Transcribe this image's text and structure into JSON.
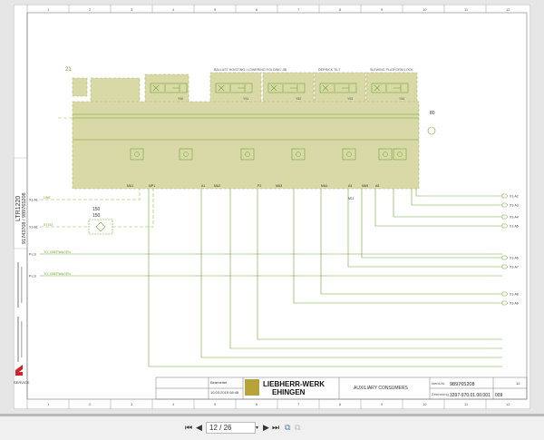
{
  "drawing": {
    "column_numbers": [
      "1",
      "2",
      "3",
      "4",
      "5",
      "6",
      "7",
      "8",
      "9",
      "10",
      "11",
      "12"
    ],
    "position_label": "21",
    "valve_groups": [
      "BALLAST HOISTING / LOWERING",
      "FOLDING JIB",
      "DERRICK TILT",
      "SLEWING PLATFORM LOCK"
    ],
    "valve_ids": [
      "Y50",
      "Y51",
      "Y52",
      "Y53",
      "Y54",
      "Y55"
    ],
    "bottom_ports": [
      "MA1",
      "MP1",
      "A1",
      "MA2",
      "P2",
      "MA3",
      "MA4",
      "A4",
      "MA5",
      "A5"
    ],
    "left_inputs": [
      "X1-A1",
      "X1-B1",
      "P-LS",
      "P-LS"
    ],
    "left_input_notes": [
      "LINE",
      "ST192",
      "TO_OBERWAGEN",
      "TO_OBERWAGEN"
    ],
    "filter_labels": [
      "150",
      "150"
    ],
    "right_outputs": [
      "X1-A2",
      "X1-A3",
      "X1-A4",
      "X1-A5",
      "X1-A6",
      "X1-A7",
      "X1-A8",
      "X1-A9"
    ],
    "gauge_label": "80",
    "sensor_label": "M11"
  },
  "side_strip": {
    "model": "LTR1220",
    "numbers": "91743708 / 989765208",
    "brand": "SERVICE"
  },
  "title_block": {
    "company_line1": "LIEBHERR-WERK",
    "company_line2": "EHINGEN",
    "title": "AUXILIARY CONSUMERS",
    "doc_label": "Ident-Nr.",
    "doc_number": "989765208",
    "drawing_label": "Zeichnung",
    "drawing_number": "3397-970.01.00.001",
    "revision": "009",
    "editor": "Bearbeitet",
    "date": "10.03.2015 08:48",
    "sheet": "12"
  },
  "viewer": {
    "page_display": "12 / 26",
    "first_label": "⏮",
    "prev_label": "◀",
    "next_label": "▶",
    "last_label": "⏭"
  }
}
